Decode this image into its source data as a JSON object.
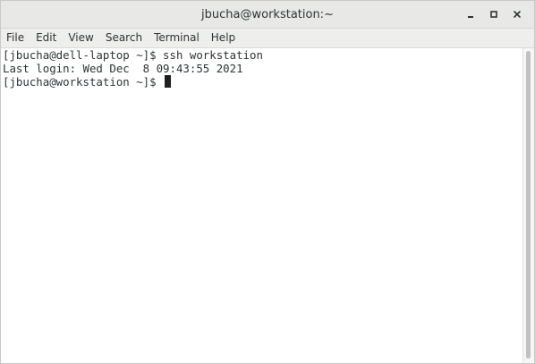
{
  "window": {
    "title": "jbucha@workstation:~",
    "controls": {
      "minimize_icon": "minimize-icon",
      "maximize_icon": "maximize-icon",
      "close_icon": "close-icon"
    }
  },
  "menubar": {
    "items": [
      "File",
      "Edit",
      "View",
      "Search",
      "Terminal",
      "Help"
    ]
  },
  "terminal": {
    "lines": [
      "[jbucha@dell-laptop ~]$ ssh workstation",
      "Last login: Wed Dec  8 09:43:55 2021",
      "[jbucha@workstation ~]$ "
    ]
  },
  "colors": {
    "titlebar": "#e8e8e7",
    "menubar": "#eeeeec",
    "terminal_bg": "#ffffff",
    "text": "#2e3436"
  }
}
